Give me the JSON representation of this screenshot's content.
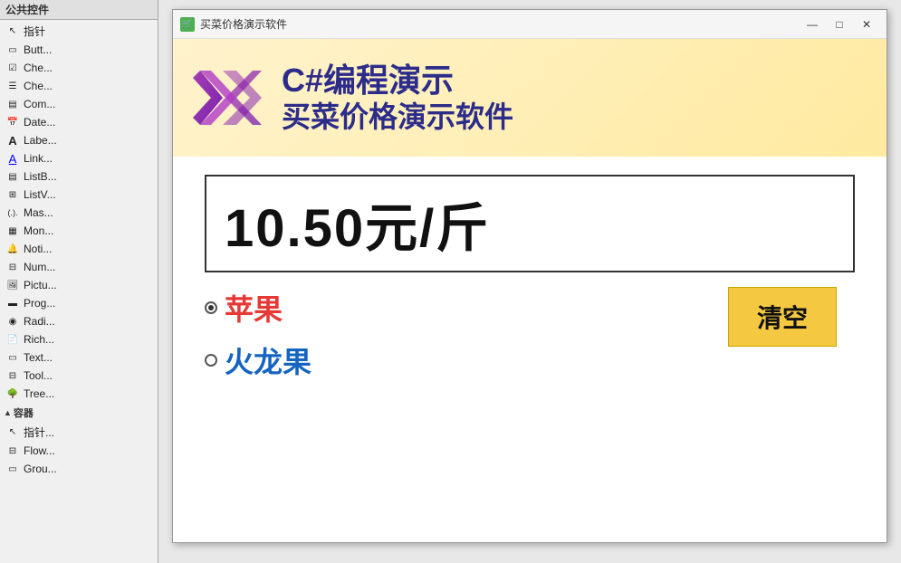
{
  "sidebar": {
    "tab1": "公共控件",
    "tab2": "指针",
    "items": [
      {
        "label": "Butt...",
        "icon": "btn"
      },
      {
        "label": "Che...",
        "icon": "chk"
      },
      {
        "label": "Che...",
        "icon": "chk2"
      },
      {
        "label": "Com...",
        "icon": "com"
      },
      {
        "label": "Date...",
        "icon": "date"
      },
      {
        "label": "Labe...",
        "icon": "A"
      },
      {
        "label": "Link...",
        "icon": "A"
      },
      {
        "label": "ListB...",
        "icon": "lb"
      },
      {
        "label": "ListV...",
        "icon": "lv"
      },
      {
        "label": "Mas...",
        "icon": "()"
      },
      {
        "label": "Mon...",
        "icon": "mon"
      },
      {
        "label": "Noti...",
        "icon": "noti"
      },
      {
        "label": "Num...",
        "icon": "num"
      },
      {
        "label": "Pictu...",
        "icon": "pic"
      },
      {
        "label": "Prog...",
        "icon": "prog"
      },
      {
        "label": "Radi...",
        "icon": "rad"
      },
      {
        "label": "Rich...",
        "icon": "rich"
      },
      {
        "label": "Text...",
        "icon": "txt"
      },
      {
        "label": "Tool...",
        "icon": "tool"
      },
      {
        "label": "Tree...",
        "icon": "tree"
      }
    ],
    "section": "容器",
    "section_items": [
      {
        "label": "指针...",
        "icon": "ptr"
      },
      {
        "label": "Flow...",
        "icon": "flow"
      },
      {
        "label": "Grou...",
        "icon": "grp"
      }
    ]
  },
  "window": {
    "title": "买菜价格演示软件",
    "min_label": "—",
    "max_label": "□",
    "close_label": "✕"
  },
  "banner": {
    "title1": "C#编程演示",
    "title2": "买菜价格演示软件"
  },
  "price": {
    "value": "10.50元/斤"
  },
  "items": [
    {
      "label": "苹果",
      "selected": true,
      "color": "red"
    },
    {
      "label": "火龙果",
      "selected": false,
      "color": "blue"
    }
  ],
  "clear_button": {
    "label": "清空"
  }
}
